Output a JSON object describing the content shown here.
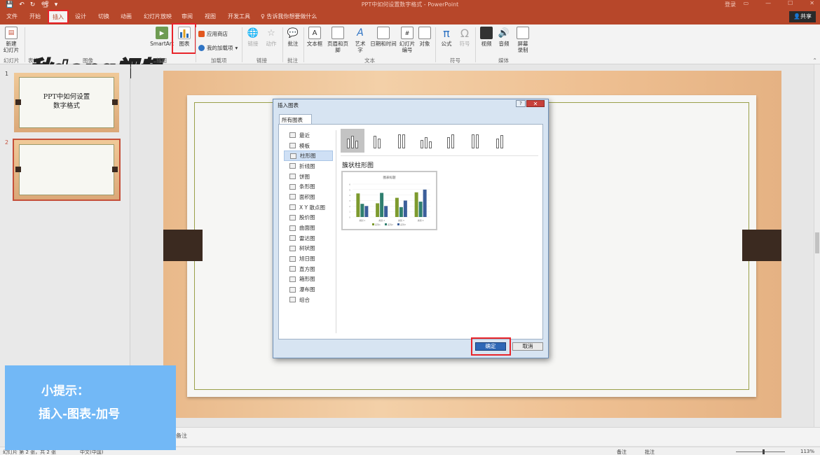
{
  "titlebar": {
    "doc_title": "PPT中如何设置数字格式 - PowerPoint",
    "login": "登录",
    "qat": [
      "💾",
      "↶",
      "↻",
      "📽",
      "▾"
    ]
  },
  "tabs": {
    "file": "文件",
    "home": "开始",
    "insert": "插入",
    "design": "设计",
    "transitions": "切换",
    "animations": "动画",
    "slideshow": "幻灯片放映",
    "review": "审阅",
    "view": "视图",
    "developer": "开发工具"
  },
  "tellme": "告诉我你想要做什么",
  "share": "共享",
  "watermark": "秋dong视频",
  "ribbon": {
    "new_slide": "新建\n幻灯片",
    "group_slides": "幻灯片",
    "group_table": "表格",
    "group_images": "图像",
    "group_illustrations": "插图",
    "smartart": "SmartArt",
    "chart": "图表",
    "store": "应用商店",
    "my_addins": "我的加载项",
    "group_addins": "加载项",
    "link": "链接",
    "action": "动作",
    "group_links": "链接",
    "comment": "批注",
    "group_comments": "批注",
    "textbox": "文本框",
    "header_footer": "页眉和页脚",
    "wordart": "艺术字",
    "datetime": "日期和时间",
    "slide_number": "幻灯片\n编号",
    "object": "对象",
    "group_text": "文本",
    "equation": "公式",
    "symbol": "符号",
    "group_symbols": "符号",
    "video": "视频",
    "audio": "音频",
    "screen_rec": "屏幕\n录制",
    "group_media": "媒体"
  },
  "thumbs": {
    "n1": "1",
    "n2": "2",
    "slide1_text": "PPT中如何设置\n数字格式"
  },
  "tip": {
    "line1": "小提示：",
    "line2": "插入-图表-加号"
  },
  "notes": "备注",
  "status": {
    "slide_pos": "幻灯片 第 2 张，共 2 张",
    "lang": "中文(中国)",
    "notes_btn": "备注",
    "comments_btn": "批注",
    "zoom": "113%"
  },
  "dialog": {
    "title": "插入图表",
    "help": "?",
    "close": "✕",
    "tab": "所有图表",
    "categories": [
      "最近",
      "模板",
      "柱形图",
      "折线图",
      "饼图",
      "条形图",
      "面积图",
      "X Y 散点图",
      "股价图",
      "曲面图",
      "雷达图",
      "树状图",
      "旭日图",
      "直方图",
      "箱形图",
      "瀑布图",
      "组合"
    ],
    "selected_category": "柱形图",
    "subtype_name": "簇状柱形图",
    "ok": "确定",
    "cancel": "取消",
    "preview_title": "图表标题"
  },
  "chart_data": {
    "type": "bar",
    "title": "图表标题",
    "categories": [
      "类别 1",
      "类别 2",
      "类别 3",
      "类别 4"
    ],
    "series": [
      {
        "name": "系列1",
        "values": [
          4.3,
          2.5,
          3.5,
          4.5
        ],
        "color": "#7d9a2e"
      },
      {
        "name": "系列2",
        "values": [
          2.4,
          4.4,
          1.8,
          2.8
        ],
        "color": "#2f7f6f"
      },
      {
        "name": "系列3",
        "values": [
          2.0,
          2.0,
          3.0,
          5.0
        ],
        "color": "#3b5e9a"
      }
    ],
    "ylim": [
      0,
      6
    ]
  },
  "colors": {
    "accent": "#b7472a",
    "highlight": "#e8242a",
    "tip_bg": "#72b8f6"
  }
}
